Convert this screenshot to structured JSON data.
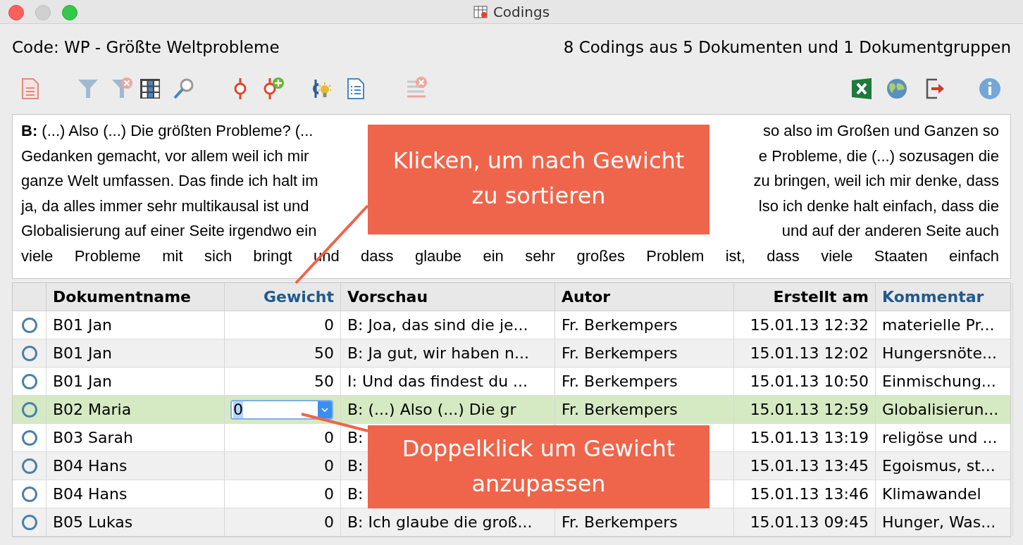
{
  "window": {
    "title": "Codings"
  },
  "header": {
    "code": "Code: WP - Größte Weltprobleme",
    "summary": "8 Codings aus 5 Dokumenten und 1 Dokumentgruppen"
  },
  "text_lines": [
    {
      "left": "**B:** (...) Also (...) Die größten Probleme? (...",
      "right": "so also im Großen und Ganzen so"
    },
    {
      "left": "Gedanken gemacht, vor allem weil ich mir",
      "right": "e Probleme, die (...) sozusagen die"
    },
    {
      "left": "ganze Welt umfassen. Das finde ich halt im",
      "right": "zu bringen, weil ich mir denke, dass"
    },
    {
      "left": "ja, da alles immer sehr multikausal ist und",
      "right": "lso ich denke halt einfach, dass die"
    },
    {
      "left": "Globalisierung auf einer Seite irgendwo ein",
      "right": "und auf der anderen Seite auch"
    },
    {
      "left": "viele Probleme mit sich bringt und dass glaube ein sehr großes Problem ist, dass viele Staaten einfach"
    }
  ],
  "table": {
    "columns": [
      {
        "label": "Dokumentname",
        "highlighted": false
      },
      {
        "label": "Gewicht",
        "highlighted": true
      },
      {
        "label": "Vorschau",
        "highlighted": false
      },
      {
        "label": "Autor",
        "highlighted": false
      },
      {
        "label": "Erstellt am",
        "highlighted": false
      },
      {
        "label": "Kommentar",
        "highlighted": true
      }
    ],
    "rows": [
      {
        "selected": false,
        "editing": false,
        "document": "B01 Jan",
        "weight": "0",
        "preview": "B: Joa, das sind die je...",
        "author": "Fr. Berkempers",
        "created": "15.01.13 12:32",
        "comment": "materielle Pr..."
      },
      {
        "selected": false,
        "editing": false,
        "document": "B01 Jan",
        "weight": "50",
        "preview": "B: Ja gut, wir haben n...",
        "author": "Fr. Berkempers",
        "created": "15.01.13 12:02",
        "comment": "Hungersnöte..."
      },
      {
        "selected": false,
        "editing": false,
        "document": "B01 Jan",
        "weight": "50",
        "preview": "I: Und das findest du ...",
        "author": "Fr. Berkempers",
        "created": "15.01.13 10:50",
        "comment": "Einmischung..."
      },
      {
        "selected": true,
        "editing": true,
        "document": "B02 Maria",
        "weight": "0",
        "preview": "B: (...) Also (...) Die gr",
        "author": "Fr. Berkempers",
        "created": "15.01.13 12:59",
        "comment": "Globalisierun..."
      },
      {
        "selected": false,
        "editing": false,
        "document": "B03 Sarah",
        "weight": "0",
        "preview": "B:",
        "created": "15.01.13 13:19",
        "comment": "religöse und ..."
      },
      {
        "selected": false,
        "editing": false,
        "document": "B04 Hans",
        "weight": "0",
        "preview": "B:",
        "created": "15.01.13 13:45",
        "comment": "Egoismus, st..."
      },
      {
        "selected": false,
        "editing": false,
        "document": "B04 Hans",
        "weight": "0",
        "preview": "B:",
        "created": "15.01.13 13:46",
        "comment": "Klimawandel"
      },
      {
        "selected": false,
        "editing": false,
        "document": "B05 Lukas",
        "weight": "0",
        "preview": "B: Ich glaube die groß...",
        "author": "Fr. Berkempers",
        "created": "15.01.13 09:45",
        "comment": "Hunger, Was..."
      }
    ]
  },
  "callouts": [
    {
      "text": "Klicken, um nach Gewicht zu sortieren"
    },
    {
      "text": "Doppelklick um Gewicht anzupassen"
    }
  ]
}
